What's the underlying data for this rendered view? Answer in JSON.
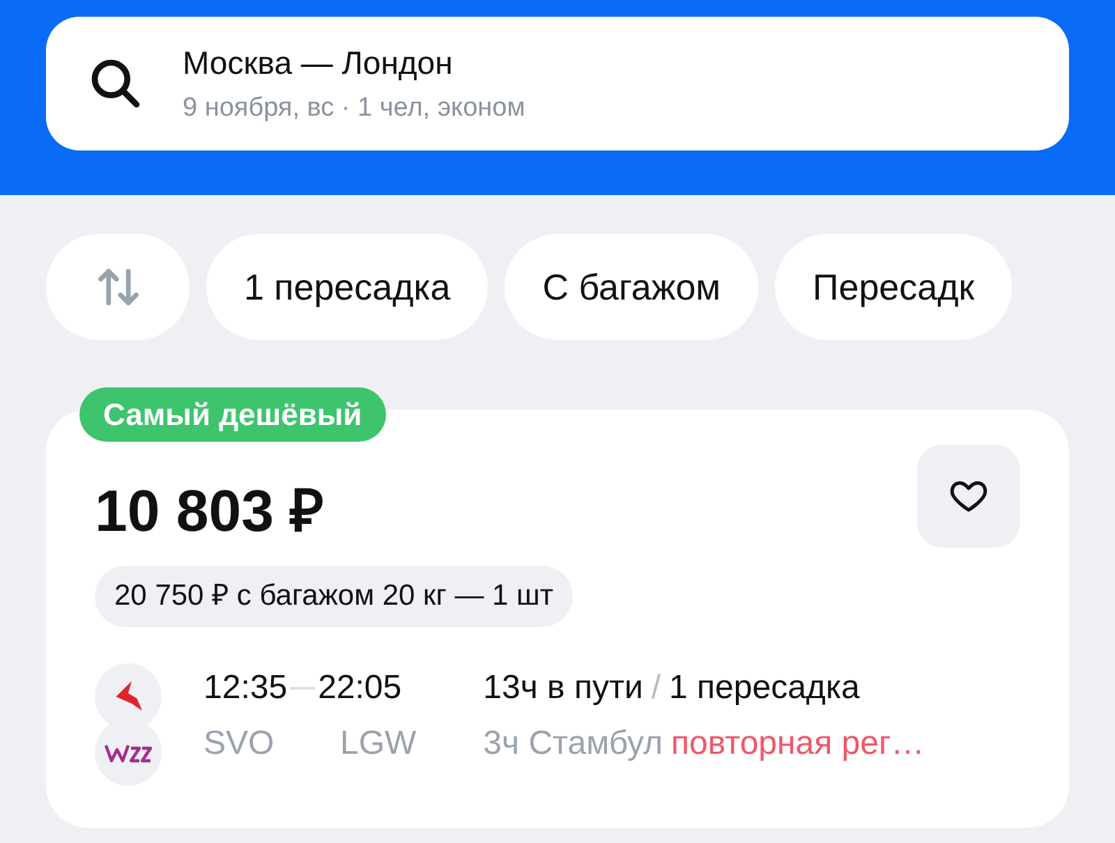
{
  "search": {
    "route": "Москва — Лондон",
    "details": "9 ноября, вс · 1 чел, эконом"
  },
  "filters": [
    {
      "kind": "sort"
    },
    {
      "kind": "text",
      "label": "1 пересадка"
    },
    {
      "kind": "text",
      "label": "С багажом"
    },
    {
      "kind": "text",
      "label": "Пересадк"
    }
  ],
  "ticket": {
    "badge": "Самый дешёвый",
    "price": "10 803 ₽",
    "favorite": false,
    "baggage_price": "20 750 ₽ с багажом 20 кг — 1 шт",
    "departure_time": "12:35",
    "arrival_time": "22:05",
    "departure_airport": "SVO",
    "arrival_airport": "LGW",
    "duration": "13ч в пути",
    "separator": "/",
    "transfers": "1 пересадка",
    "layover": "3ч Стамбул",
    "warning": "повторная рег…"
  }
}
